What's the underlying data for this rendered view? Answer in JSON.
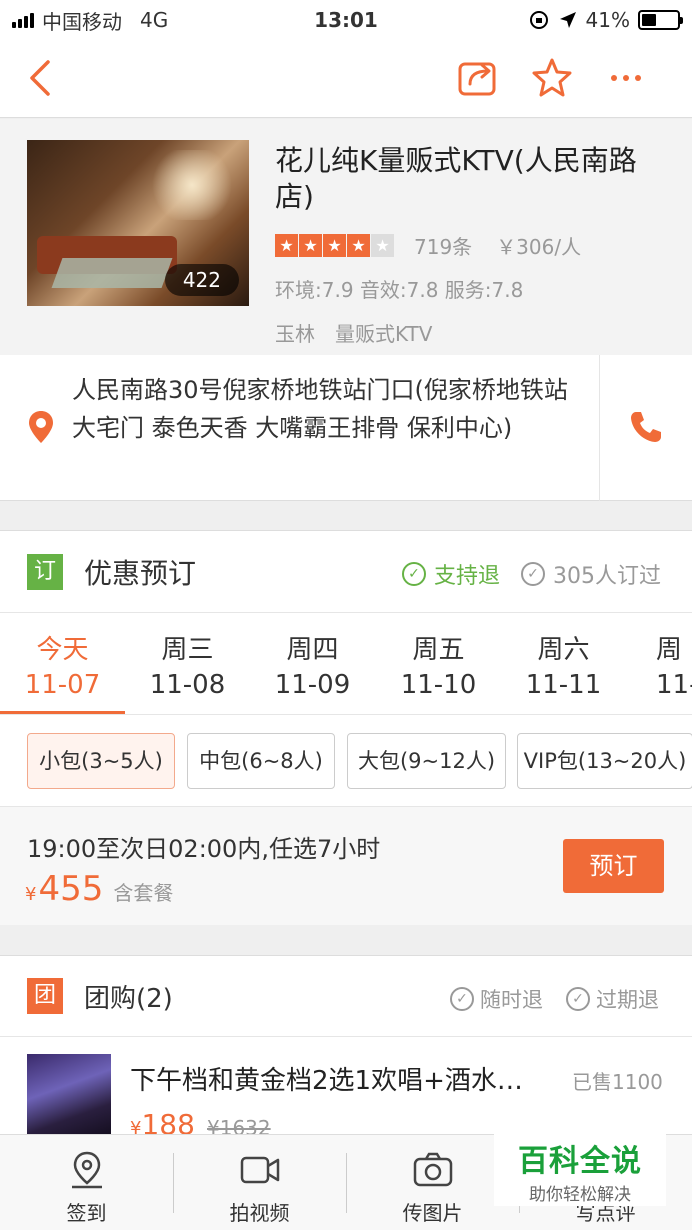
{
  "status_bar": {
    "carrier": "中国移动",
    "network": "4G",
    "time": "13:01",
    "battery": "41%",
    "battery_level": 0.41
  },
  "nav": {
    "back_icon": "chevron-left-icon",
    "share_icon": "share-icon",
    "favorite_icon": "star-icon",
    "more_icon": "more-icon"
  },
  "shop": {
    "name": "花儿纯K量贩式KTV(人民南路店)",
    "photo_count": "422",
    "stars": 4,
    "reviews": "719条",
    "price_per_person": "￥306/人",
    "scores": "环境:7.9 音效:7.8 服务:7.8",
    "area": "玉林",
    "category": "量贩式KTV"
  },
  "address": {
    "text": "人民南路30号倪家桥地铁站门口(倪家桥地铁站 大宅门 泰色天香 大嘴霸王排骨 保利中心)"
  },
  "booking": {
    "badge": "订",
    "title": "优惠预订",
    "support_refund": "支持退",
    "booked_count": "305人订过",
    "dates": [
      {
        "day": "今天",
        "md": "11-07",
        "active": true
      },
      {
        "day": "周三",
        "md": "11-08"
      },
      {
        "day": "周四",
        "md": "11-09"
      },
      {
        "day": "周五",
        "md": "11-10"
      },
      {
        "day": "周六",
        "md": "11-11"
      },
      {
        "day": "周",
        "md": "11-"
      }
    ],
    "rooms": [
      "小包(3~5人)",
      "中包(6~8人)",
      "大包(9~12人)",
      "VIP包(13~20人)"
    ],
    "package": {
      "desc": "19:00至次日02:00内,任选7小时",
      "currency": "¥",
      "price": "455",
      "note": "含套餐",
      "button": "预订"
    }
  },
  "group_buy": {
    "badge": "团",
    "title": "团购(2)",
    "anytime_refund": "随时退",
    "expired_refund": "过期退",
    "deal": {
      "title": "下午档和黄金档2选1欢唱+酒水…",
      "sold": "已售1100",
      "currency": "¥",
      "price": "188",
      "original_price": "¥1632"
    }
  },
  "tabbar": {
    "items": [
      {
        "label": "签到",
        "icon": "location-icon"
      },
      {
        "label": "拍视频",
        "icon": "video-icon"
      },
      {
        "label": "传图片",
        "icon": "camera-icon"
      },
      {
        "label": "写点评",
        "icon": "edit-icon"
      }
    ]
  },
  "watermark": {
    "title": "百科全说",
    "subtitle": "助你轻松解决"
  },
  "colors": {
    "accent": "#f06b38",
    "green": "#66b245"
  }
}
